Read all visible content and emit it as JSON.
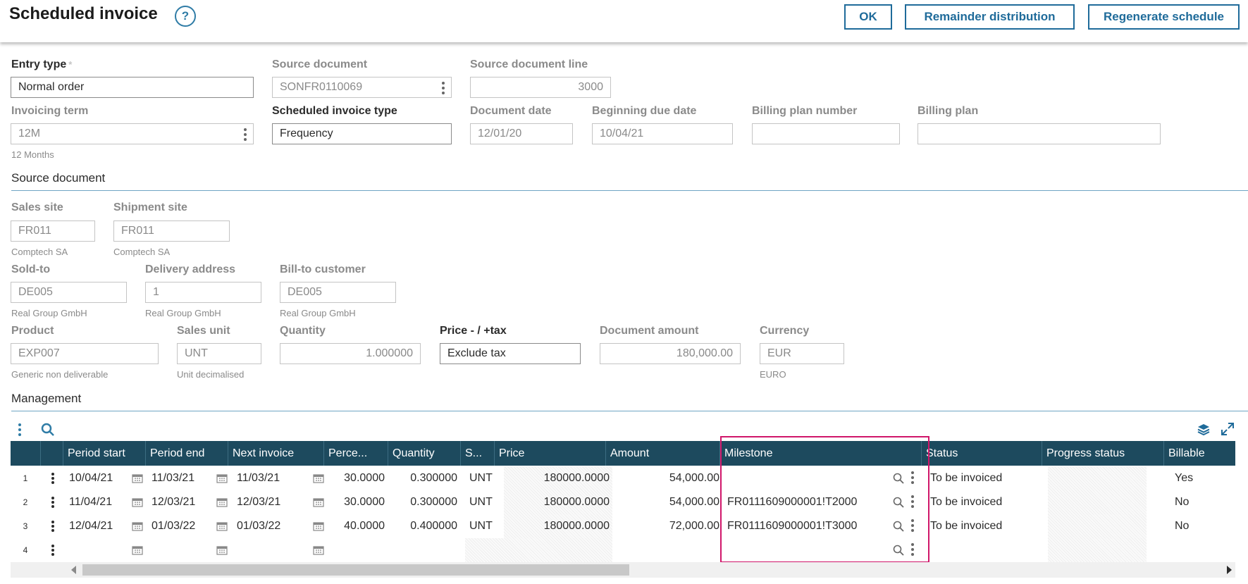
{
  "header": {
    "title": "Scheduled invoice",
    "help_glyph": "?",
    "ok_label": "OK",
    "remainder_label": "Remainder distribution",
    "regenerate_label": "Regenerate schedule"
  },
  "fields": {
    "entry_type": {
      "label": "Entry type",
      "required_mark": "*",
      "value": "Normal order"
    },
    "source_document": {
      "label": "Source document",
      "value": "SONFR0110069"
    },
    "source_document_line": {
      "label": "Source document line",
      "value": "3000"
    },
    "invoicing_term": {
      "label": "Invoicing term",
      "value": "12M",
      "description": "12 Months"
    },
    "scheduled_invoice_type": {
      "label": "Scheduled invoice type",
      "value": "Frequency"
    },
    "document_date": {
      "label": "Document date",
      "value": "12/01/20"
    },
    "beginning_due_date": {
      "label": "Beginning due date",
      "value": "10/04/21"
    },
    "billing_plan_number": {
      "label": "Billing plan number",
      "value": ""
    },
    "billing_plan": {
      "label": "Billing plan",
      "value": ""
    }
  },
  "source_section": {
    "title": "Source document",
    "sales_site": {
      "label": "Sales site",
      "value": "FR011",
      "description": "Comptech SA"
    },
    "shipment_site": {
      "label": "Shipment site",
      "value": "FR011",
      "description": "Comptech SA"
    },
    "sold_to": {
      "label": "Sold-to",
      "value": "DE005",
      "description": "Real Group GmbH"
    },
    "delivery_address": {
      "label": "Delivery address",
      "value": "1",
      "description": "Real Group GmbH"
    },
    "bill_to": {
      "label": "Bill-to customer",
      "value": "DE005",
      "description": "Real Group GmbH"
    },
    "product": {
      "label": "Product",
      "value": "EXP007",
      "description": "Generic non deliverable"
    },
    "sales_unit": {
      "label": "Sales unit",
      "value": "UNT",
      "description": "Unit decimalised"
    },
    "quantity": {
      "label": "Quantity",
      "value": "1.000000"
    },
    "price_tax": {
      "label": "Price - / +tax",
      "value": "Exclude tax"
    },
    "document_amount": {
      "label": "Document amount",
      "value": "180,000.00"
    },
    "currency": {
      "label": "Currency",
      "value": "EUR",
      "description": "EURO"
    }
  },
  "management": {
    "title": "Management",
    "columns": [
      "Period start",
      "Period end",
      "Next invoice",
      "Perce...",
      "Quantity",
      "S...",
      "Price",
      "Amount",
      "Milestone",
      "Status",
      "Progress status",
      "Billable"
    ],
    "rows": [
      {
        "num": "1",
        "period_start": "10/04/21",
        "period_end": "11/03/21",
        "next_invoice": "11/03/21",
        "percent": "30.0000",
        "quantity": "0.300000",
        "unit": "UNT",
        "price": "180000.0000",
        "amount": "54,000.00",
        "milestone": "",
        "status": "To be invoiced",
        "billable": "Yes"
      },
      {
        "num": "2",
        "period_start": "11/04/21",
        "period_end": "12/03/21",
        "next_invoice": "12/03/21",
        "percent": "30.0000",
        "quantity": "0.300000",
        "unit": "UNT",
        "price": "180000.0000",
        "amount": "54,000.00",
        "milestone": "FR0111609000001!T2000",
        "status": "To be invoiced",
        "billable": "No"
      },
      {
        "num": "3",
        "period_start": "12/04/21",
        "period_end": "01/03/22",
        "next_invoice": "01/03/22",
        "percent": "40.0000",
        "quantity": "0.400000",
        "unit": "UNT",
        "price": "180000.0000",
        "amount": "72,000.00",
        "milestone": "FR0111609000001!T3000",
        "status": "To be invoiced",
        "billable": "No"
      },
      {
        "num": "4",
        "period_start": "",
        "period_end": "",
        "next_invoice": "",
        "percent": "",
        "quantity": "",
        "unit": "",
        "price": "",
        "amount": "",
        "milestone": "",
        "status": "",
        "billable": ""
      }
    ],
    "highlight_color": "#d0166a"
  },
  "colors": {
    "accent": "#1f6b9a",
    "grid_header": "#1d4a5e"
  }
}
